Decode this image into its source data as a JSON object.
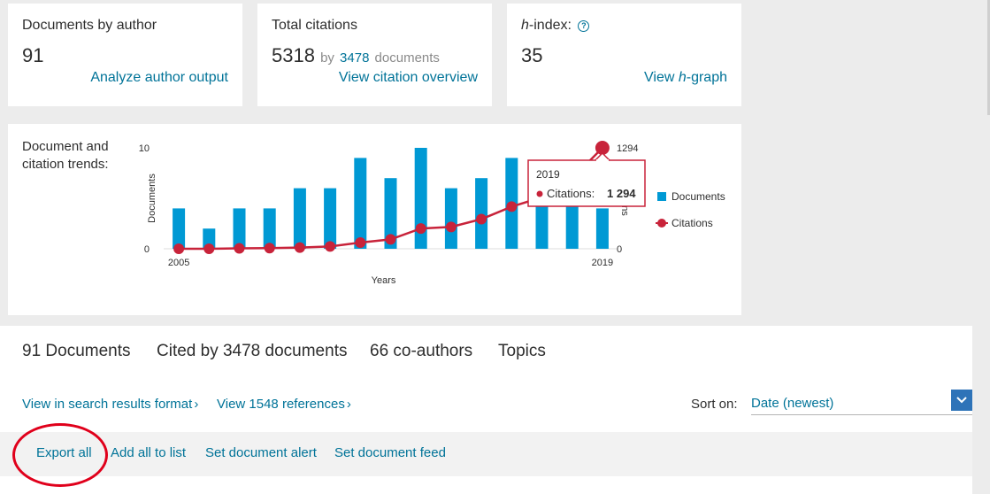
{
  "cards": {
    "documents": {
      "title": "Documents by author",
      "value": "91",
      "link": "Analyze author output"
    },
    "citations": {
      "title": "Total citations",
      "value": "5318",
      "by": "by",
      "docs_count": "3478",
      "docs_label": "documents",
      "link": "View citation overview"
    },
    "hindex": {
      "title_italic": "h",
      "title_rest": "-index:",
      "help_icon": "?",
      "value": "35",
      "link_pre": "View ",
      "link_italic": "h",
      "link_post": "-graph"
    }
  },
  "trends": {
    "label": "Document and citation trends:"
  },
  "chart_data": {
    "type": "bar+line",
    "x": [
      2005,
      2006,
      2007,
      2008,
      2009,
      2010,
      2011,
      2012,
      2013,
      2014,
      2015,
      2016,
      2017,
      2018,
      2019
    ],
    "series": [
      {
        "name": "Documents",
        "type": "bar",
        "axis": "left",
        "color": "#0099d4",
        "values": [
          4,
          2,
          4,
          4,
          6,
          6,
          9,
          7,
          10,
          6,
          7,
          9,
          8,
          6,
          4
        ]
      },
      {
        "name": "Citations",
        "type": "line",
        "axis": "right",
        "color": "#c8233a",
        "values": [
          0,
          0,
          5,
          8,
          15,
          30,
          80,
          120,
          260,
          280,
          380,
          540,
          660,
          900,
          1294
        ]
      }
    ],
    "xlabel": "Years",
    "ylabel_left": "Documents",
    "ylabel_right_visible": "ns",
    "left_ticks": [
      "10",
      "0"
    ],
    "right_ticks": [
      "1294",
      "0"
    ],
    "x_ticks": [
      "2005",
      "2019"
    ],
    "ylim_left": [
      0,
      10
    ],
    "ylim_right": [
      0,
      1294
    ],
    "legend": [
      "Documents",
      "Citations"
    ],
    "legend_position": "right",
    "tooltip": {
      "year": "2019",
      "label": "Citations:",
      "value": "1 294"
    }
  },
  "tabs": [
    {
      "label": "91 Documents",
      "active": true
    },
    {
      "label": "Cited by 3478 documents",
      "active": false
    },
    {
      "label": "66 co-authors",
      "active": false
    },
    {
      "label": "Topics",
      "active": false
    }
  ],
  "actions": {
    "search_format": "View in search results format",
    "references": "View 1548 references",
    "chevron": "›",
    "sort_label": "Sort on:",
    "sort_value": "Date (newest)"
  },
  "toolbar": {
    "export_all": "Export all",
    "add_all": "Add all to list",
    "set_alert": "Set document alert",
    "set_feed": "Set document feed"
  },
  "colors": {
    "accent": "#007398",
    "bar": "#0099d4",
    "line": "#c8233a",
    "tab_active": "#e9711c",
    "annotation": "#e0001b"
  }
}
